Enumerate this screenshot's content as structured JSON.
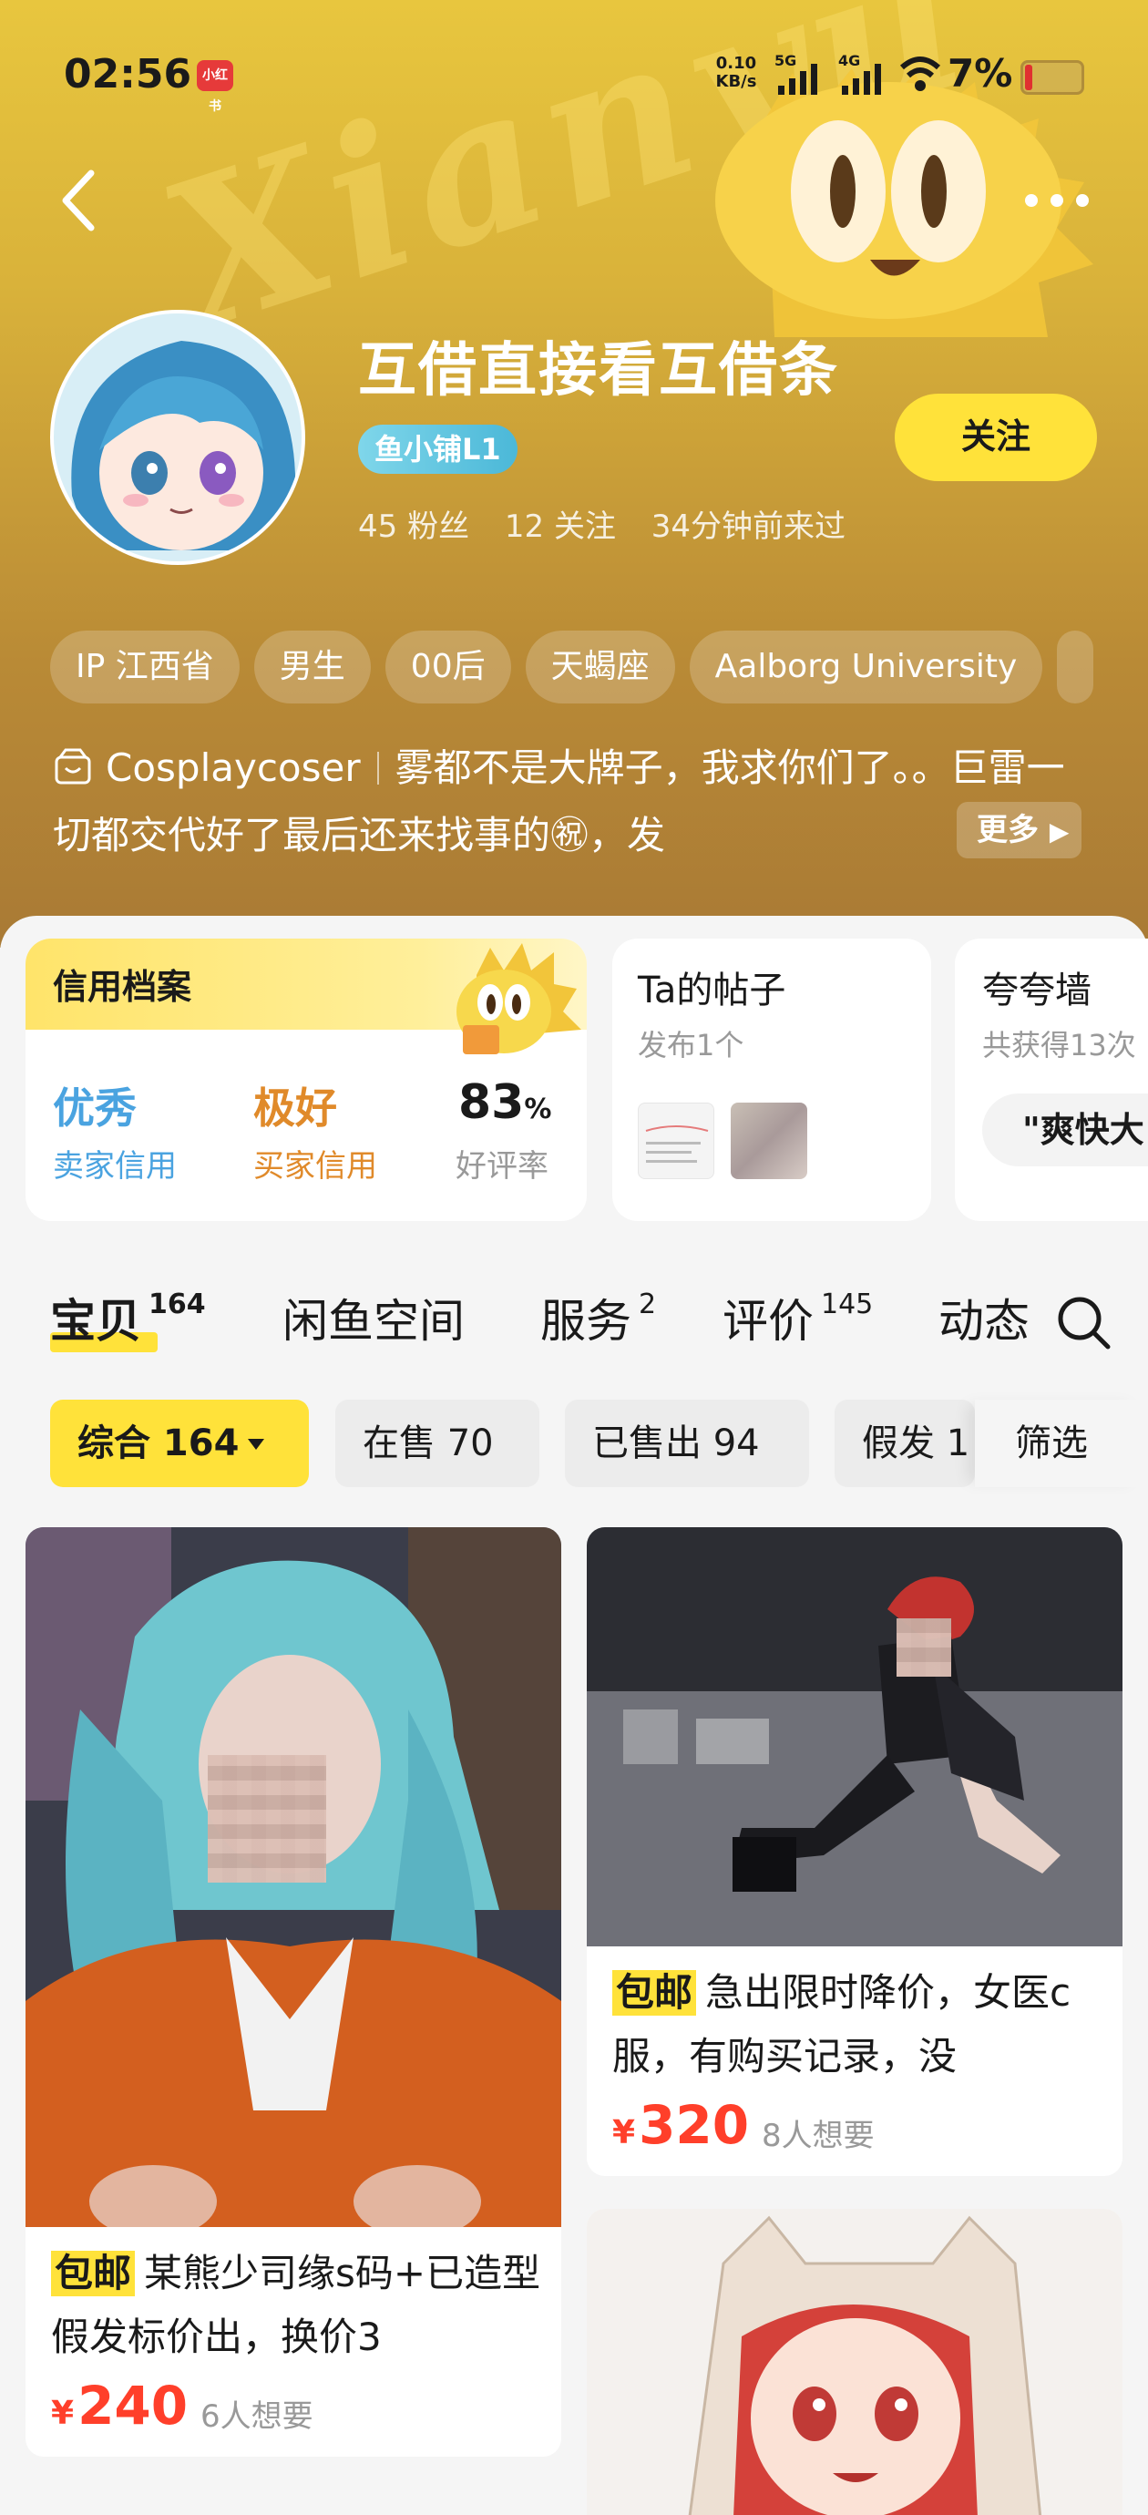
{
  "status_bar": {
    "time": "02:56",
    "app_badge": "小红书",
    "net_speed_value": "0.10",
    "net_speed_unit": "KB/s",
    "sig1_label": "5G",
    "sig2_label": "4G",
    "battery": "7%"
  },
  "profile": {
    "name": "互借直接看互借条",
    "shop_badge": "鱼小铺L1",
    "fans": "45 粉丝",
    "following": "12 关注",
    "last_seen": "34分钟前来过",
    "follow_label": "关注"
  },
  "tags": [
    "IP 江西省",
    "男生",
    "00后",
    "天蝎座",
    "Aalborg University"
  ],
  "bio": {
    "category": "Cosplaycoser",
    "text": "雾都不是大牌子，我求你们了。。巨雷一切都交代好了最后还来找事的㊗，发",
    "more_label": "更多"
  },
  "credit_card": {
    "title": "信用档案",
    "seller_rating": "优秀",
    "seller_label": "卖家信用",
    "buyer_rating": "极好",
    "buyer_label": "买家信用",
    "good_rate": "83",
    "good_rate_unit": "%",
    "good_rate_label": "好评率"
  },
  "posts_card": {
    "title": "Ta的帖子",
    "subtitle": "发布1个"
  },
  "praise_card": {
    "title": "夸夸墙",
    "subtitle": "共获得13次",
    "chip": "\"爽快大"
  },
  "tabs": [
    {
      "label": "宝贝",
      "count": "164"
    },
    {
      "label": "闲鱼空间",
      "count": ""
    },
    {
      "label": "服务",
      "count": "2"
    },
    {
      "label": "评价",
      "count": "145"
    },
    {
      "label": "动态",
      "count": ""
    }
  ],
  "filters": {
    "all": "综合 164",
    "on_sale": "在售 70",
    "sold": "已售出 94",
    "wig": "假发 1",
    "screen": "筛选"
  },
  "products": [
    {
      "badge": "包邮",
      "title": "某熊少司缘s码+已造型假发标价出，换价3",
      "price": "240",
      "want": "6人想要"
    },
    {
      "badge": "包邮",
      "title": "急出限时降价，女医c服，有购买记录，没",
      "price": "320",
      "want": "8人想要"
    }
  ],
  "currency": "¥",
  "colors": {
    "accent_yellow": "#ffe23a",
    "price_red": "#ff3f2a",
    "seller_blue": "#4aa3e0",
    "buyer_orange": "#e08a2a"
  }
}
